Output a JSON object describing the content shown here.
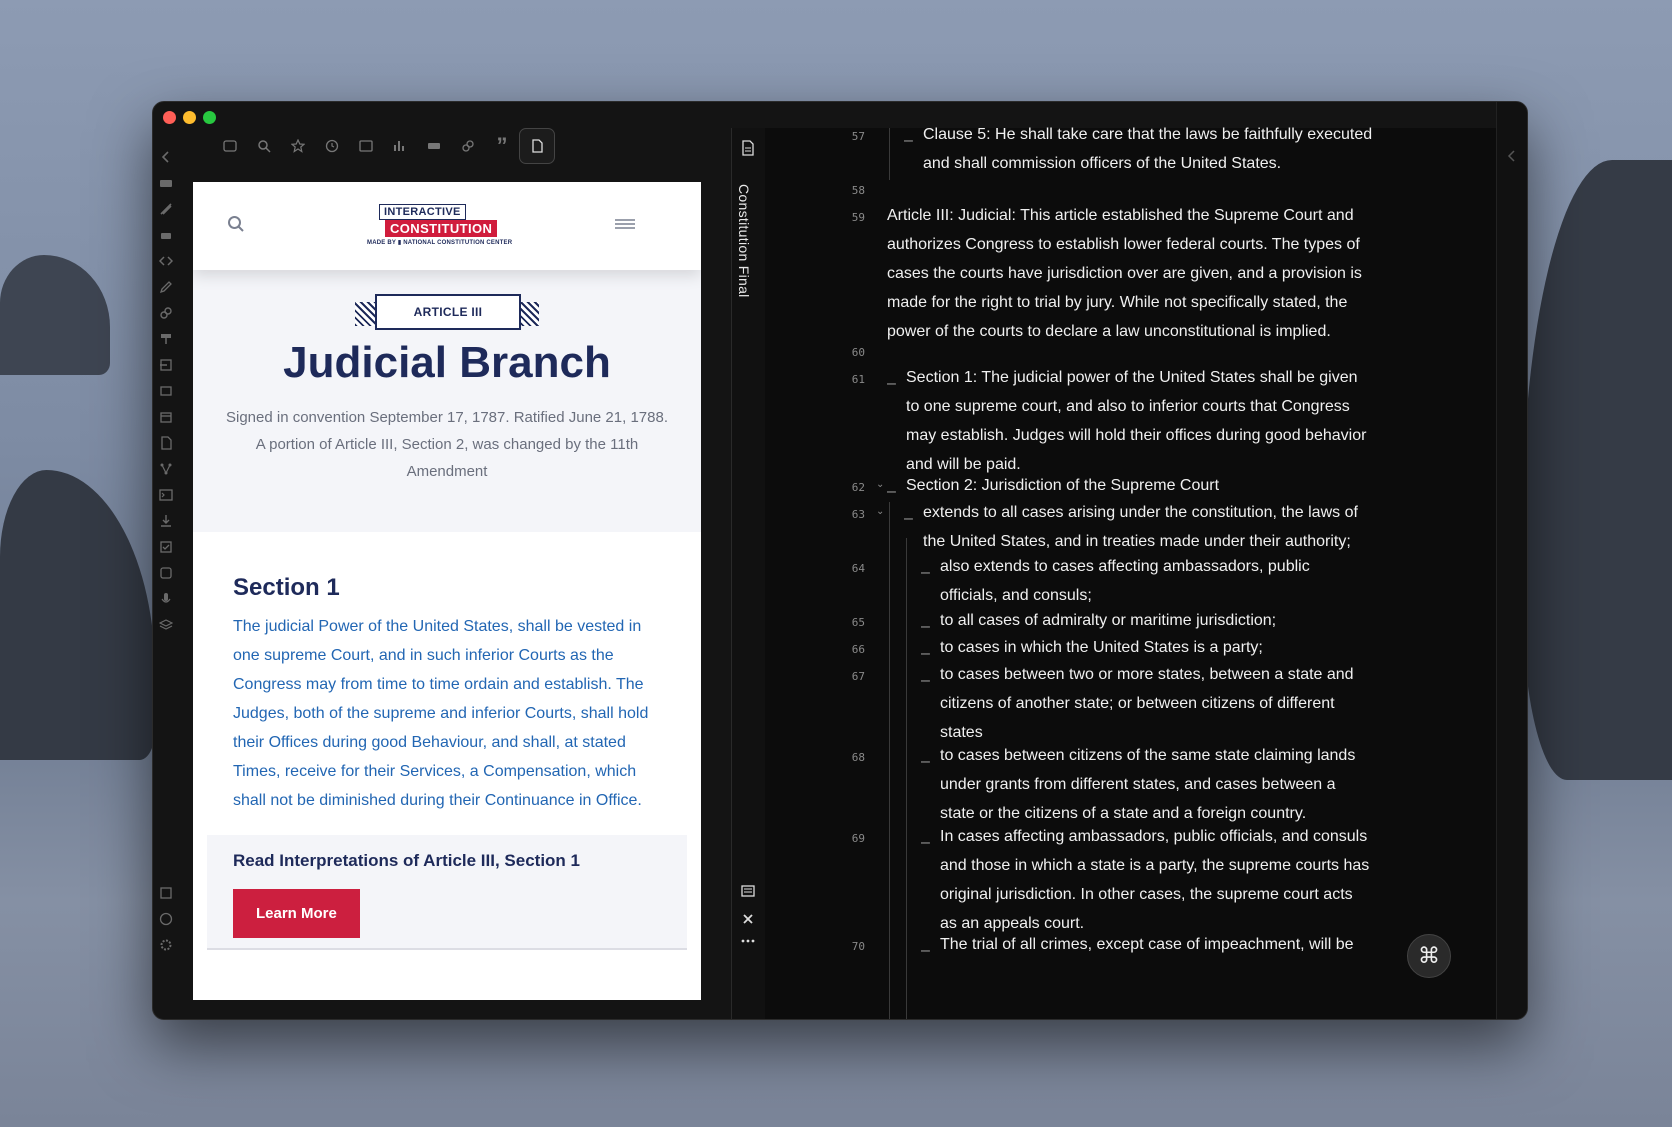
{
  "window": {
    "browser": {
      "logo": {
        "line1": "INTERACTIVE",
        "line2": "CONSTITUTION",
        "line3": "MADE BY ▮ NATIONAL CONSTITUTION CENTER"
      },
      "hero": {
        "ribbon": "ARTICLE III",
        "title": "Judicial Branch",
        "signed": "Signed in convention September 17, 1787. Ratified June 21, 1788. A portion of Article III, Section 2, was changed by the 11th Amendment"
      },
      "section": {
        "heading": "Section 1",
        "body": "The judicial Power of the United States, shall be vested in one supreme Court, and in such inferior Courts as the Congress may from time to time ordain and establish. The Judges, both of the supreme and inferior Courts, shall hold their Offices during good Behaviour, and shall, at stated Times, receive for their Services, a Compensation, which shall not be diminished during their Continuance in Office.",
        "interp_title": "Read Interpretations of Article III, Section 1",
        "learn_more": "Learn More"
      }
    },
    "doc_tab": "Constitution Final",
    "editor": {
      "lines": [
        {
          "n": "57",
          "indent": 1,
          "dash": true,
          "text": "Clause 5: He shall take care that the laws be faithfully executed and shall commission officers of the United States."
        },
        {
          "n": "58",
          "indent": 0,
          "dash": false,
          "text": ""
        },
        {
          "n": "59",
          "indent": 0,
          "dash": false,
          "text": "Article III: Judicial: This article established the Supreme Court and authorizes Congress to establish lower federal courts. The types of cases the courts have jurisdiction over are given, and a provision is made for the right to trial by jury. While not specifically stated, the power of the courts to declare a law unconstitutional is implied."
        },
        {
          "n": "60",
          "indent": 0,
          "dash": false,
          "text": ""
        },
        {
          "n": "61",
          "indent": 0,
          "dash": true,
          "text": "Section 1: The judicial power of the United States shall be given to one supreme court, and also to inferior courts that Congress may establish. Judges will hold their offices during good behavior and will be paid."
        },
        {
          "n": "62",
          "indent": 0,
          "dash": true,
          "text": "Section 2: Jurisdiction of the Supreme Court"
        },
        {
          "n": "63",
          "indent": 1,
          "dash": true,
          "text": "extends to all cases arising under the constitution, the laws of the United States, and in treaties made under their authority;"
        },
        {
          "n": "64",
          "indent": 2,
          "dash": true,
          "text": "also extends to cases affecting ambassadors, public officials, and consuls;"
        },
        {
          "n": "65",
          "indent": 2,
          "dash": true,
          "text": "to all cases of admiralty or maritime jurisdiction;"
        },
        {
          "n": "66",
          "indent": 2,
          "dash": true,
          "text": "to cases in which the United States is a party;"
        },
        {
          "n": "67",
          "indent": 2,
          "dash": true,
          "text": "to cases between two or more states, between a state and citizens of another state; or between citizens of different states"
        },
        {
          "n": "68",
          "indent": 2,
          "dash": true,
          "text": "to cases between citizens of the same state claiming lands under grants from different states, and cases between a state or the citizens of a state and a foreign country."
        },
        {
          "n": "69",
          "indent": 2,
          "dash": true,
          "text": "In cases affecting ambassadors, public officials, and consuls and those in which a state is a party, the supreme courts has original jurisdiction. In other cases, the supreme court acts as an appeals court."
        },
        {
          "n": "70",
          "indent": 2,
          "dash": true,
          "text": "The trial of all crimes, except case of impeachment, will be"
        }
      ],
      "cmd_symbol": "⌘"
    }
  }
}
